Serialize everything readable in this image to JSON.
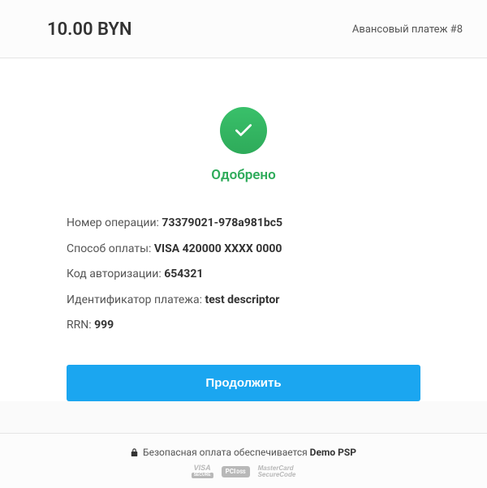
{
  "header": {
    "amount": "10.00 BYN",
    "payment_ref": "Авансовый платеж #8"
  },
  "status": {
    "text": "Одобрено"
  },
  "details": [
    {
      "label": "Номер операции: ",
      "value": "73379021-978a981bc5"
    },
    {
      "label": "Способ оплаты: ",
      "value": "VISA 420000 XXXX 0000"
    },
    {
      "label": "Код авторизации: ",
      "value": "654321"
    },
    {
      "label": "Идентификатор платежа: ",
      "value": "test descriptor"
    },
    {
      "label": "RRN: ",
      "value": "999"
    }
  ],
  "continue_label": "Продолжить",
  "footer": {
    "secure_prefix": "Безопасная оплата обеспечивается ",
    "psp": "Demo PSP",
    "badges": {
      "visa": "VISA",
      "visa_sub": "SECURE",
      "pci": "PCI",
      "pci_dss": "DSS",
      "mc_top": "MasterCard",
      "mc_bot": "SecureCode"
    }
  }
}
